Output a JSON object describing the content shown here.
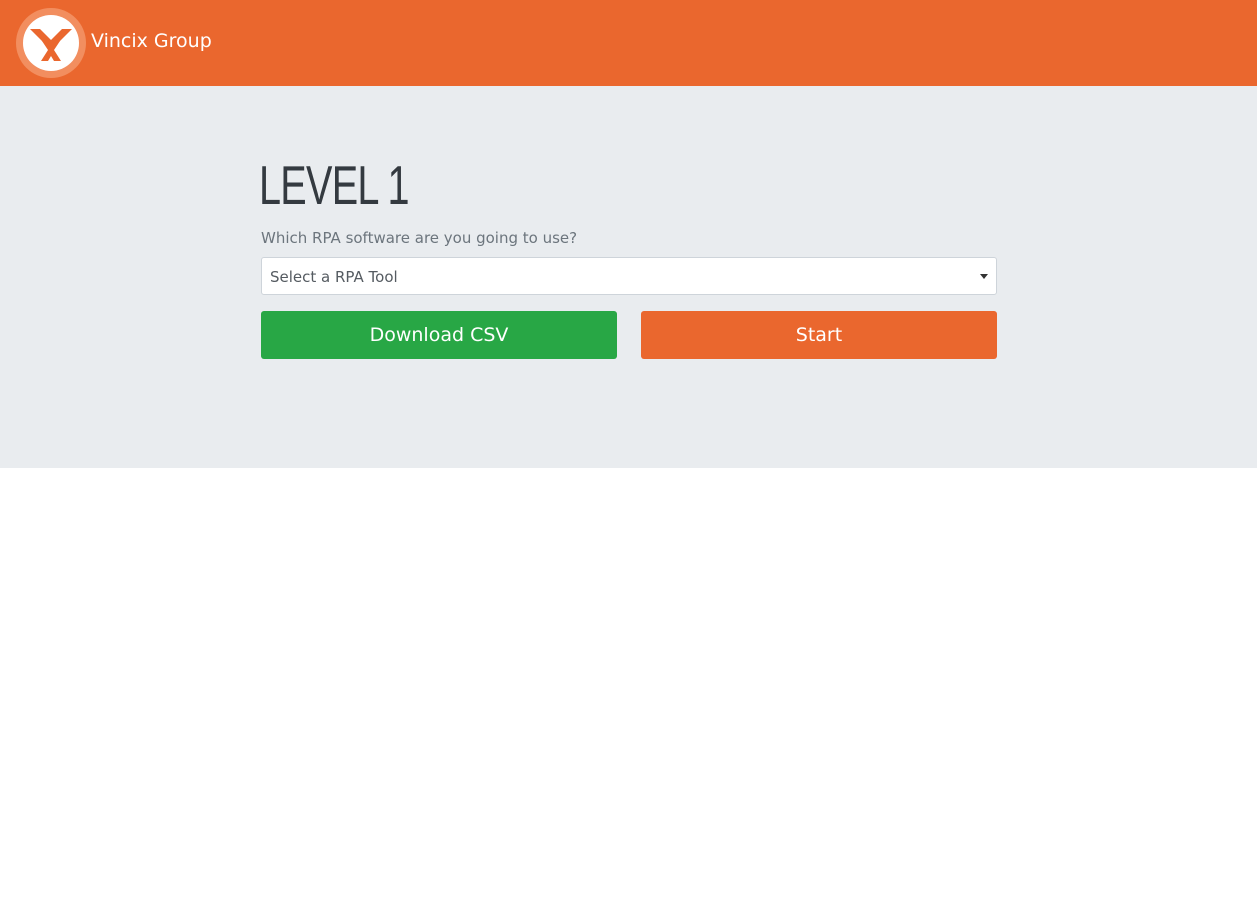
{
  "colors": {
    "brand": "#ea672e",
    "success": "#28a745",
    "jumbotron_bg": "#e9ecef"
  },
  "header": {
    "logo_icon": "vincix-x-logo-icon",
    "brand_name": "Vincix Group"
  },
  "main": {
    "title": "LEVEL 1",
    "question": "Which RPA software are you going to use?",
    "select": {
      "selected_text": "Select a RPA Tool",
      "icon": "caret-down-icon"
    },
    "buttons": {
      "download_label": "Download CSV",
      "start_label": "Start"
    }
  }
}
